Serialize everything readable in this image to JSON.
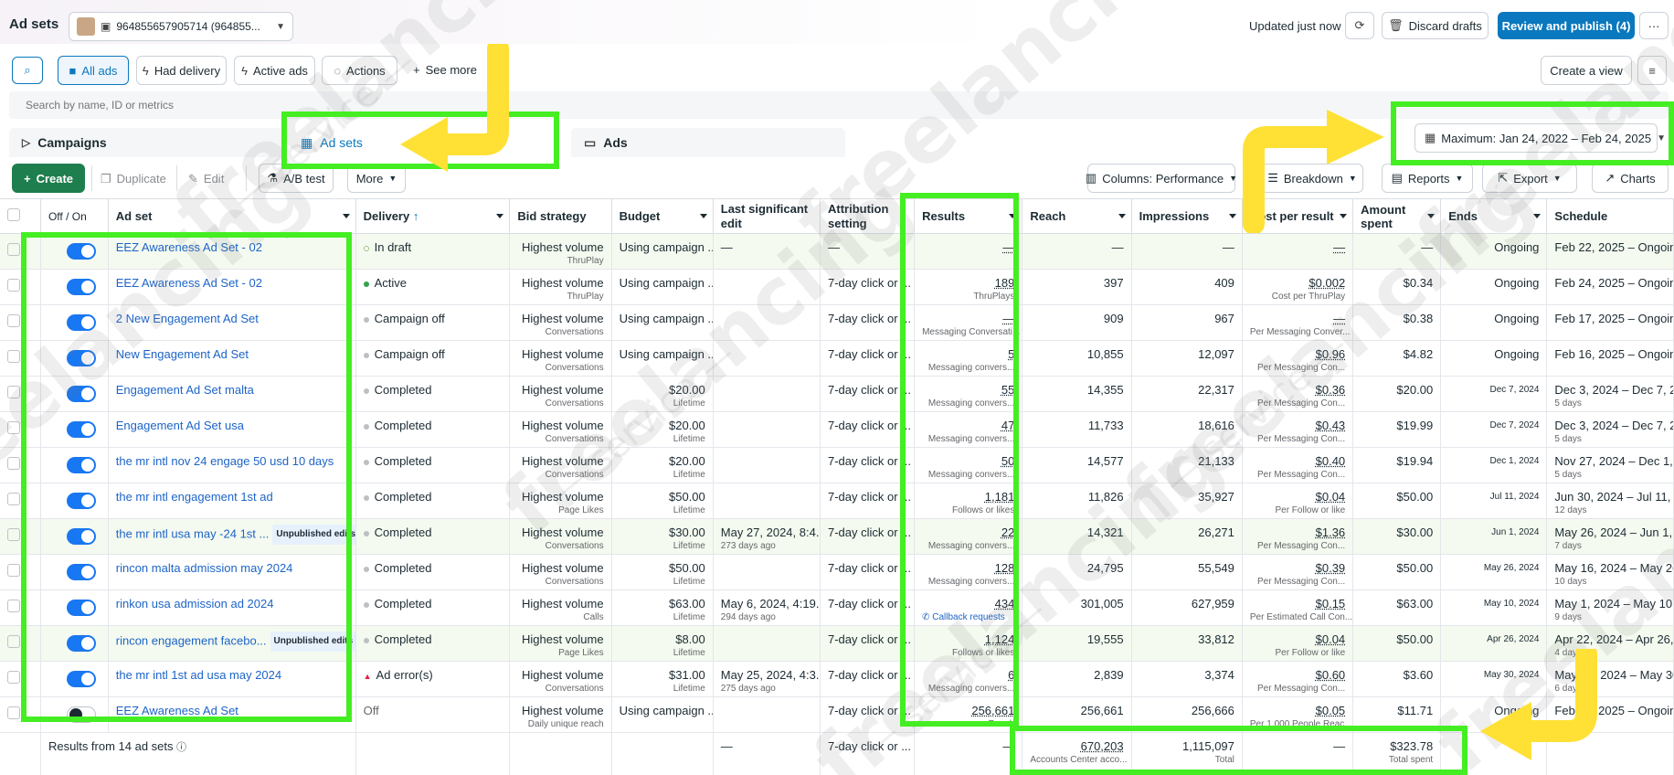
{
  "header": {
    "title": "Ad sets",
    "account_id": "964855657905714 (964855...",
    "updated": "Updated just now",
    "discard": "Discard drafts",
    "publish": "Review and publish (4)",
    "more": "···"
  },
  "filters": {
    "all_ads": "All ads",
    "had_delivery": "Had delivery",
    "active_ads": "Active ads",
    "actions": "Actions",
    "see_more": "See more",
    "create_view": "Create a view"
  },
  "search": {
    "placeholder": "Search by name, ID or metrics"
  },
  "tabs": {
    "campaigns": "Campaigns",
    "adsets": "Ad sets",
    "ads": "Ads"
  },
  "date_range": "Maximum: Jan 24, 2022 – Feb 24, 2025",
  "toolbar": {
    "create": "Create",
    "duplicate": "Duplicate",
    "edit": "Edit",
    "ab_test": "A/B test",
    "more": "More",
    "columns": "Columns: Performance",
    "breakdown": "Breakdown",
    "reports": "Reports",
    "export": "Export",
    "charts": "Charts"
  },
  "columns": {
    "offon": "Off / On",
    "adset": "Ad set",
    "delivery": "Delivery",
    "bid": "Bid strategy",
    "budget": "Budget",
    "last_edit": "Last significant edit",
    "attribution": "Attribution setting",
    "results": "Results",
    "reach": "Reach",
    "impressions": "Impressions",
    "cpr": "Cost per result",
    "spent": "Amount spent",
    "ends": "Ends",
    "schedule": "Schedule"
  },
  "rows": [
    {
      "on": true,
      "name": "EEZ Awareness Ad Set - 02",
      "badge": "",
      "delivery": "In draft",
      "dcolor": "#a0c080",
      "dring": true,
      "bid": "Highest volume",
      "bidsub": "ThruPlay",
      "budget": "Using campaign ...",
      "budsub": "",
      "edit": "—",
      "editsub": "",
      "attr": "—",
      "res": "—",
      "ressub": "",
      "reach": "—",
      "impr": "—",
      "cpr": "—",
      "cprsub": "",
      "spent": "—",
      "ends": "Ongoing",
      "endsmall": false,
      "sched": "Feb 22, 2025 – Ongoing",
      "schedsub": ""
    },
    {
      "on": true,
      "name": "EEZ Awareness Ad Set - 02",
      "badge": "",
      "delivery": "Active",
      "dcolor": "#31a24c",
      "bid": "Highest volume",
      "bidsub": "ThruPlay",
      "budget": "Using campaign ...",
      "budsub": "",
      "edit": "",
      "editsub": "",
      "attr": "7-day click or ...",
      "res": "189",
      "ressub": "ThruPlays",
      "reach": "397",
      "impr": "409",
      "cpr": "$0.002",
      "cprsub": "Cost per ThruPlay",
      "spent": "$0.34",
      "ends": "Ongoing",
      "endsmall": false,
      "sched": "Feb 24, 2025 – Ongoing",
      "schedsub": ""
    },
    {
      "on": true,
      "name": "2 New Engagement Ad Set",
      "badge": "",
      "delivery": "Campaign off",
      "dcolor": "#bcc0c4",
      "bid": "Highest volume",
      "bidsub": "Conversations",
      "budget": "Using campaign ...",
      "budsub": "",
      "edit": "",
      "editsub": "",
      "attr": "7-day click or ...",
      "res": "—",
      "ressub": "Messaging Conversati...",
      "reach": "909",
      "impr": "967",
      "cpr": "—",
      "cprsub": "Per Messaging Conver...",
      "spent": "$0.38",
      "ends": "Ongoing",
      "endsmall": false,
      "sched": "Feb 17, 2025 – Ongoing",
      "schedsub": ""
    },
    {
      "on": true,
      "name": "New Engagement Ad Set",
      "badge": "",
      "delivery": "Campaign off",
      "dcolor": "#bcc0c4",
      "bid": "Highest volume",
      "bidsub": "Conversations",
      "budget": "Using campaign ...",
      "budsub": "",
      "edit": "",
      "editsub": "",
      "attr": "7-day click or ...",
      "res": "5",
      "ressub": "Messaging convers...",
      "reach": "10,855",
      "impr": "12,097",
      "cpr": "$0.96",
      "cprsub": "Per Messaging Con...",
      "spent": "$4.82",
      "ends": "Ongoing",
      "endsmall": false,
      "sched": "Feb 16, 2025 – Ongoing",
      "schedsub": ""
    },
    {
      "on": true,
      "name": "Engagement Ad Set malta",
      "badge": "",
      "delivery": "Completed",
      "dcolor": "#bcc0c4",
      "bid": "Highest volume",
      "bidsub": "Conversations",
      "budget": "$20.00",
      "budsub": "Lifetime",
      "edit": "",
      "editsub": "",
      "attr": "7-day click or ...",
      "res": "55",
      "ressub": "Messaging convers...",
      "reach": "14,355",
      "impr": "22,317",
      "cpr": "$0.36",
      "cprsub": "Per Messaging Con...",
      "spent": "$20.00",
      "ends": "Dec 7, 2024",
      "endsmall": true,
      "sched": "Dec 3, 2024 – Dec 7, 2024",
      "schedsub": "5 days"
    },
    {
      "on": true,
      "name": "Engagement Ad Set usa",
      "badge": "",
      "delivery": "Completed",
      "dcolor": "#bcc0c4",
      "bid": "Highest volume",
      "bidsub": "Conversations",
      "budget": "$20.00",
      "budsub": "Lifetime",
      "edit": "",
      "editsub": "",
      "attr": "7-day click or ...",
      "res": "47",
      "ressub": "Messaging convers...",
      "reach": "11,733",
      "impr": "18,616",
      "cpr": "$0.43",
      "cprsub": "Per Messaging Con...",
      "spent": "$19.99",
      "ends": "Dec 7, 2024",
      "endsmall": true,
      "sched": "Dec 3, 2024 – Dec 7, 2024",
      "schedsub": "5 days"
    },
    {
      "on": true,
      "name": "the mr intl nov 24 engage 50 usd 10 days",
      "badge": "",
      "delivery": "Completed",
      "dcolor": "#bcc0c4",
      "bid": "Highest volume",
      "bidsub": "Conversations",
      "budget": "$20.00",
      "budsub": "Lifetime",
      "edit": "",
      "editsub": "",
      "attr": "7-day click or ...",
      "res": "50",
      "ressub": "Messaging convers...",
      "reach": "14,577",
      "impr": "21,133",
      "cpr": "$0.40",
      "cprsub": "Per Messaging Con...",
      "spent": "$19.94",
      "ends": "Dec 1, 2024",
      "endsmall": true,
      "sched": "Nov 27, 2024 – Dec 1, 2024",
      "schedsub": "5 days"
    },
    {
      "on": true,
      "name": "the mr intl engagement 1st ad",
      "badge": "",
      "delivery": "Completed",
      "dcolor": "#bcc0c4",
      "bid": "Highest volume",
      "bidsub": "Page Likes",
      "budget": "$50.00",
      "budsub": "Lifetime",
      "edit": "",
      "editsub": "",
      "attr": "7-day click or ...",
      "res": "1,181",
      "ressub": "Follows or likes",
      "reach": "11,826",
      "impr": "35,927",
      "cpr": "$0.04",
      "cprsub": "Per Follow or like",
      "spent": "$50.00",
      "ends": "Jul 11, 2024",
      "endsmall": true,
      "sched": "Jun 30, 2024 – Jul 11, 2024",
      "schedsub": "12 days"
    },
    {
      "on": true,
      "name": "the mr intl usa may -24 1st ...",
      "badge": "Unpublished edits",
      "delivery": "Completed",
      "dcolor": "#bcc0c4",
      "bid": "Highest volume",
      "bidsub": "Conversations",
      "budget": "$30.00",
      "budsub": "Lifetime",
      "edit": "May 27, 2024, 8:4...",
      "editsub": "273 days ago",
      "attr": "7-day click or ...",
      "res": "22",
      "ressub": "Messaging convers...",
      "reach": "14,321",
      "impr": "26,271",
      "cpr": "$1.36",
      "cprsub": "Per Messaging Con...",
      "spent": "$30.00",
      "ends": "Jun 1, 2024",
      "endsmall": true,
      "sched": "May 26, 2024 – Jun 1, 2024",
      "schedsub": "7 days"
    },
    {
      "on": true,
      "name": "rincon malta admission may 2024",
      "badge": "",
      "delivery": "Completed",
      "dcolor": "#bcc0c4",
      "bid": "Highest volume",
      "bidsub": "Conversations",
      "budget": "$50.00",
      "budsub": "Lifetime",
      "edit": "",
      "editsub": "",
      "attr": "7-day click or ...",
      "res": "128",
      "ressub": "Messaging convers...",
      "reach": "24,795",
      "impr": "55,549",
      "cpr": "$0.39",
      "cprsub": "Per Messaging Con...",
      "spent": "$50.00",
      "ends": "May 26, 2024",
      "endsmall": true,
      "sched": "May 16, 2024 – May 26, 2024",
      "schedsub": "10 days"
    },
    {
      "on": true,
      "name": "rinkon usa admission ad 2024",
      "badge": "",
      "delivery": "Completed",
      "dcolor": "#bcc0c4",
      "bid": "Highest volume",
      "bidsub": "Calls",
      "budget": "$63.00",
      "budsub": "Lifetime",
      "edit": "May 6, 2024, 4:19...",
      "editsub": "294 days ago",
      "attr": "7-day click or ...",
      "res": "434",
      "ressub": "Callback requests",
      "reach": "301,005",
      "impr": "627,959",
      "cpr": "$0.15",
      "cprsub": "Per Estimated Call Con...",
      "spent": "$63.00",
      "ends": "May 10, 2024",
      "endsmall": true,
      "sched": "May 1, 2024 – May 10, 2024",
      "schedsub": "9 days"
    },
    {
      "on": true,
      "name": "rincon engagement facebo...",
      "badge": "Unpublished edits",
      "delivery": "Completed",
      "dcolor": "#bcc0c4",
      "bid": "Highest volume",
      "bidsub": "Page Likes",
      "budget": "$8.00",
      "budsub": "Lifetime",
      "edit": "",
      "editsub": "",
      "attr": "7-day click or ...",
      "res": "1,124",
      "ressub": "Follows or likes",
      "reach": "19,555",
      "impr": "33,812",
      "cpr": "$0.04",
      "cprsub": "Per Follow or like",
      "spent": "$50.00",
      "ends": "Apr 26, 2024",
      "endsmall": true,
      "sched": "Apr 22, 2024 – Apr 26, 2024",
      "schedsub": "4 days"
    },
    {
      "on": true,
      "name": "the mr intl 1st ad usa may 2024",
      "badge": "",
      "delivery": "Ad error(s)",
      "dcolor": "#e41e3f",
      "derr": true,
      "bid": "Highest volume",
      "bidsub": "Conversations",
      "budget": "$31.00",
      "budsub": "Lifetime",
      "edit": "May 25, 2024, 4:3...",
      "editsub": "275 days ago",
      "attr": "7-day click or ...",
      "res": "6",
      "ressub": "Messaging convers...",
      "reach": "2,839",
      "impr": "3,374",
      "cpr": "$0.60",
      "cprsub": "Per Messaging Con...",
      "spent": "$3.60",
      "ends": "May 30, 2024",
      "endsmall": true,
      "sched": "May 25, 2024 – May 30, 2024",
      "schedsub": "6 days"
    },
    {
      "on": false,
      "name": "EEZ Awareness Ad Set",
      "badge": "",
      "delivery": "Off",
      "dcolor": "",
      "bid": "Highest volume",
      "bidsub": "Daily unique reach",
      "budget": "Using campaign ...",
      "budsub": "",
      "edit": "",
      "editsub": "",
      "attr": "7-day click or ...",
      "res": "256,661",
      "ressub": "Reach",
      "reach": "256,661",
      "impr": "256,666",
      "cpr": "$0.05",
      "cprsub": "Per 1,000 People Reac...",
      "spent": "$11.71",
      "ends": "Ongoing",
      "endsmall": false,
      "sched": "Feb 21, 2025 – Ongoing",
      "schedsub": ""
    }
  ],
  "summary": {
    "label": "Results from 14 ad sets",
    "edit": "—",
    "attr": "7-day click or ...",
    "res": "—",
    "reach": "670,203",
    "reachsub": "Accounts Center acco...",
    "impr": "1,115,097",
    "imprsub": "Total",
    "cpr": "—",
    "spent": "$323.78",
    "spentsub": "Total spent"
  },
  "watermark": {
    "text": "freelancing",
    "sub": "— service —"
  },
  "colors": {
    "publish": "#0a78be",
    "create": "#1e7e4e",
    "highlight": "#44ee22",
    "arrow": "#ffe135"
  }
}
